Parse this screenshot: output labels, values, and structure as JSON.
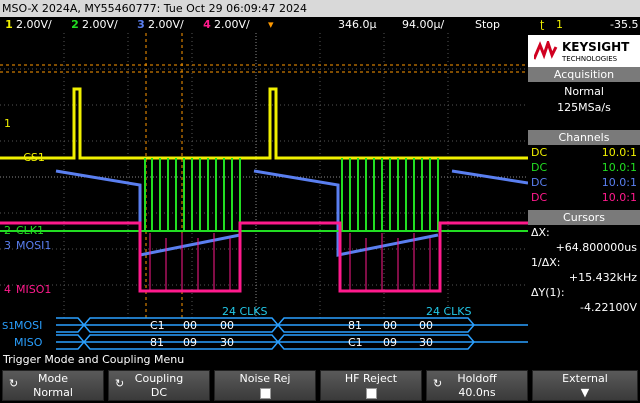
{
  "title_bar": "MSO-X 2024A, MY55460777: Tue Oct 29 06:09:47 2024",
  "status": {
    "ch1": {
      "num": "1",
      "scale": "2.00V/",
      "color": "#f0f000"
    },
    "ch2": {
      "num": "2",
      "scale": "2.00V/",
      "color": "#22dd22"
    },
    "ch3": {
      "num": "3",
      "scale": "2.00V/",
      "color": "#5a7ff0"
    },
    "ch4": {
      "num": "4",
      "scale": "2.00V/",
      "color": "#ff1a8c"
    },
    "time_scale": "346.0µ",
    "delay": "94.00µ/",
    "run_state": "Stop",
    "trigger_source": "1",
    "trigger_level": "-35.5"
  },
  "labels": {
    "cs": "~CS1",
    "clk": "CLK1",
    "mosi": "MOSI1",
    "miso": "MISO1",
    "bus_mosi": "MOSI",
    "bus_miso": "MISO",
    "clks_1": "24 CLKS",
    "clks_2": "24 CLKS",
    "ch_marker_1": "1",
    "ch_marker_2": "2",
    "ch_marker_3": "3",
    "ch_marker_4": "4",
    "bus_marker": "S1"
  },
  "decode": {
    "mosi_frame1": [
      "C1",
      "00",
      "00"
    ],
    "miso_frame1": [
      "81",
      "09",
      "30"
    ],
    "mosi_frame2": [
      "81",
      "00",
      "00"
    ],
    "miso_frame2": [
      "C1",
      "09",
      "30"
    ]
  },
  "sidebar": {
    "brand": "KEYSIGHT",
    "brand_sub": "TECHNOLOGIES",
    "acquisition_header": "Acquisition",
    "acq_mode": "Normal",
    "acq_rate": "125MSa/s",
    "channels_header": "Channels",
    "channels": [
      {
        "coupling": "DC",
        "probe": "10.0:1",
        "color": "#f0f000"
      },
      {
        "coupling": "DC",
        "probe": "10.0:1",
        "color": "#22dd22"
      },
      {
        "coupling": "DC",
        "probe": "10.0:1",
        "color": "#5a7ff0"
      },
      {
        "coupling": "DC",
        "probe": "10.0:1",
        "color": "#ff1a8c"
      }
    ],
    "cursors_header": "Cursors",
    "dx_label": "ΔX:",
    "dx_value": "+64.800000us",
    "inv_dx_label": "1/ΔX:",
    "inv_dx_value": "+15.432kHz",
    "dy_label": "ΔY(1):",
    "dy_value": "-4.22100V"
  },
  "menu": {
    "title": "Trigger Mode and Coupling Menu",
    "softkeys": [
      {
        "label": "Mode",
        "value": "Normal"
      },
      {
        "label": "Coupling",
        "value": "DC"
      },
      {
        "label": "Noise Rej",
        "value": ""
      },
      {
        "label": "HF Reject",
        "value": ""
      },
      {
        "label": "Holdoff",
        "value": "40.0ns"
      },
      {
        "label": "External",
        "value": ""
      }
    ]
  },
  "colors": {
    "ch1": "#f0f000",
    "ch2": "#22dd22",
    "ch3": "#5a7ff0",
    "ch4": "#ff1a8c",
    "bus": "#2aa0ff",
    "clks_text": "#22c8e8",
    "cursor": "#ff9900"
  }
}
